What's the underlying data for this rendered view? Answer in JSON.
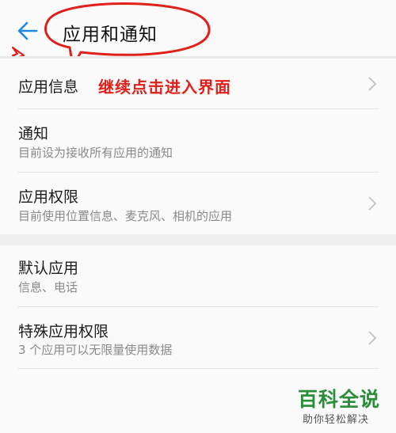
{
  "header": {
    "title": "应用和通知",
    "back_icon": "back-arrow-icon",
    "accent_color": "#1e88e5"
  },
  "annotation": {
    "text": "继续点击进入界面",
    "color": "#e0201b",
    "bubble_color": "#e0201b"
  },
  "sections": [
    {
      "items": [
        {
          "label": "应用信息",
          "subtitle": "",
          "chevron": true
        },
        {
          "label": "通知",
          "subtitle": "目前设为接收所有应用的通知",
          "chevron": false
        },
        {
          "label": "应用权限",
          "subtitle": "目前使用位置信息、麦克风、相机的应用",
          "chevron": true
        }
      ]
    },
    {
      "items": [
        {
          "label": "默认应用",
          "subtitle": "信息、电话",
          "chevron": false
        },
        {
          "label": "特殊应用权限",
          "subtitle": "3 个应用可以无限量使用数据",
          "chevron": true
        }
      ]
    }
  ],
  "watermark": {
    "main": "百科全说",
    "sub": "助你轻松解决",
    "color": "#2a8d3a"
  }
}
